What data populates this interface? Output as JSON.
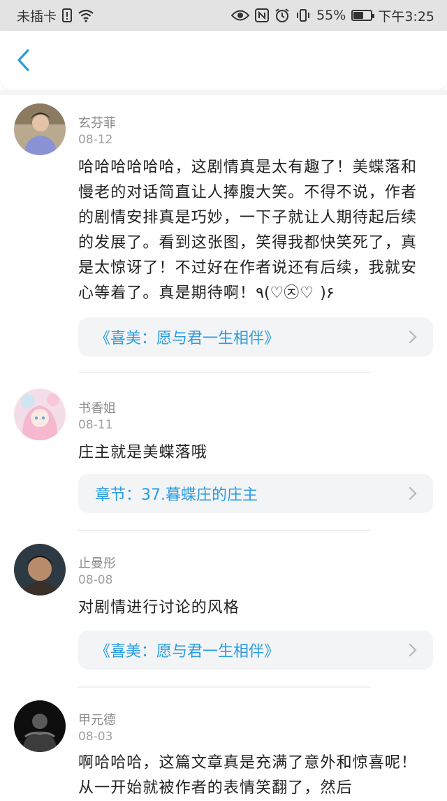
{
  "status_bar": {
    "carrier": "未插卡",
    "battery_percent": "55%",
    "battery_level": 0.55,
    "time": "下午3:25",
    "icons": [
      "sim-alert-icon",
      "wifi-icon",
      "eye-icon",
      "nfc-icon",
      "alarm-icon",
      "vibrate-icon",
      "battery-icon"
    ]
  },
  "nav": {
    "back_icon": "chevron-left-icon",
    "accent": "#2a9ce0"
  },
  "comments": [
    {
      "name": "玄芬菲",
      "date": "08-12",
      "text": "哈哈哈哈哈哈，这剧情真是太有趣了！美蝶落和慢老的对话简直让人捧腹大笑。不得不说，作者的剧情安排真是巧妙，一下子就让人期待起后续的发展了。看到这张图，笑得我都快笑死了，真是太惊讶了！不过好在作者说还有后续，我就安心等着了。真是期待啊！٩(♡㉨♡ )۶",
      "ref": "《喜美：愿与君一生相伴》"
    },
    {
      "name": "书香姐",
      "date": "08-11",
      "text": "庄主就是美蝶落哦",
      "ref": "章节：37.暮蝶庄的庄主"
    },
    {
      "name": "止曼彤",
      "date": "08-08",
      "text": "对剧情进行讨论的风格",
      "ref": "《喜美：愿与君一生相伴》"
    },
    {
      "name": "甲元德",
      "date": "08-03",
      "text": "啊哈哈哈，这篇文章真是充满了意外和惊喜呢！从一开始就被作者的表情笑翻了，然后"
    }
  ]
}
